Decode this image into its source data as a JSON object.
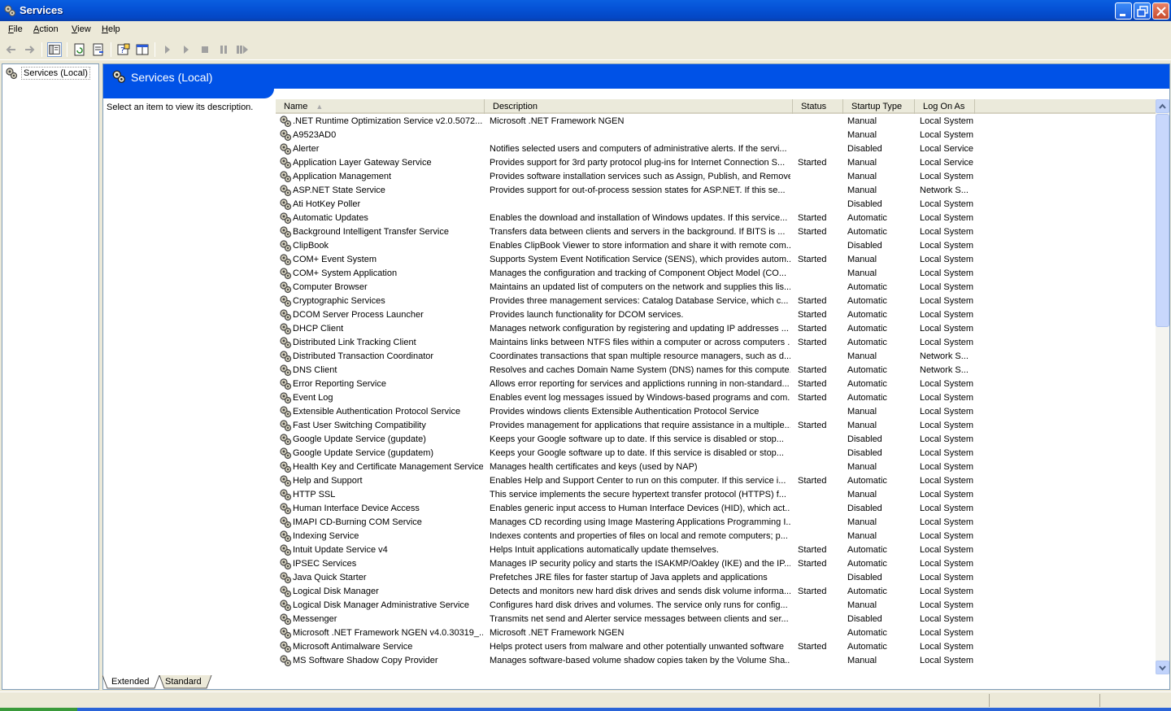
{
  "window": {
    "title": "Services"
  },
  "menu": [
    {
      "label": "File",
      "mnemonic": "F",
      "rest": "ile"
    },
    {
      "label": "Action",
      "mnemonic": "A",
      "rest": "ction"
    },
    {
      "label": "View",
      "mnemonic": "V",
      "rest": "iew"
    },
    {
      "label": "Help",
      "mnemonic": "H",
      "rest": "elp"
    }
  ],
  "tree": {
    "root_label": "Services (Local)"
  },
  "banner": {
    "title": "Services (Local)"
  },
  "description_pane": {
    "text": "Select an item to view its description."
  },
  "columns": [
    "Name",
    "Description",
    "Status",
    "Startup Type",
    "Log On As"
  ],
  "rows": [
    [
      ".NET Runtime Optimization Service v2.0.5072...",
      "Microsoft .NET Framework NGEN",
      "",
      "Manual",
      "Local System"
    ],
    [
      "A9523AD0",
      "",
      "",
      "Manual",
      "Local System"
    ],
    [
      "Alerter",
      "Notifies selected users and computers of administrative alerts. If the servi...",
      "",
      "Disabled",
      "Local Service"
    ],
    [
      "Application Layer Gateway Service",
      "Provides support for 3rd party protocol plug-ins for Internet Connection S...",
      "Started",
      "Manual",
      "Local Service"
    ],
    [
      "Application Management",
      "Provides software installation services such as Assign, Publish, and Remove.",
      "",
      "Manual",
      "Local System"
    ],
    [
      "ASP.NET State Service",
      "Provides support for out-of-process session states for ASP.NET. If this se...",
      "",
      "Manual",
      "Network S..."
    ],
    [
      "Ati HotKey Poller",
      "",
      "",
      "Disabled",
      "Local System"
    ],
    [
      "Automatic Updates",
      "Enables the download and installation of Windows updates. If this service...",
      "Started",
      "Automatic",
      "Local System"
    ],
    [
      "Background Intelligent Transfer Service",
      "Transfers data between clients and servers in the background. If BITS is ...",
      "Started",
      "Automatic",
      "Local System"
    ],
    [
      "ClipBook",
      "Enables ClipBook Viewer to store information and share it with remote com...",
      "",
      "Disabled",
      "Local System"
    ],
    [
      "COM+ Event System",
      "Supports System Event Notification Service (SENS), which provides autom...",
      "Started",
      "Manual",
      "Local System"
    ],
    [
      "COM+ System Application",
      "Manages the configuration and tracking of Component Object Model (CO...",
      "",
      "Manual",
      "Local System"
    ],
    [
      "Computer Browser",
      "Maintains an updated list of computers on the network and supplies this lis...",
      "",
      "Automatic",
      "Local System"
    ],
    [
      "Cryptographic Services",
      "Provides three management services: Catalog Database Service, which c...",
      "Started",
      "Automatic",
      "Local System"
    ],
    [
      "DCOM Server Process Launcher",
      "Provides launch functionality for DCOM services.",
      "Started",
      "Automatic",
      "Local System"
    ],
    [
      "DHCP Client",
      "Manages network configuration by registering and updating IP addresses ...",
      "Started",
      "Automatic",
      "Local System"
    ],
    [
      "Distributed Link Tracking Client",
      "Maintains links between NTFS files within a computer or across computers ...",
      "Started",
      "Automatic",
      "Local System"
    ],
    [
      "Distributed Transaction Coordinator",
      "Coordinates transactions that span multiple resource managers, such as d...",
      "",
      "Manual",
      "Network S..."
    ],
    [
      "DNS Client",
      "Resolves and caches Domain Name System (DNS) names for this compute...",
      "Started",
      "Automatic",
      "Network S..."
    ],
    [
      "Error Reporting Service",
      "Allows error reporting for services and applictions running in non-standard...",
      "Started",
      "Automatic",
      "Local System"
    ],
    [
      "Event Log",
      "Enables event log messages issued by Windows-based programs and com...",
      "Started",
      "Automatic",
      "Local System"
    ],
    [
      "Extensible Authentication Protocol Service",
      "Provides windows clients Extensible Authentication Protocol Service",
      "",
      "Manual",
      "Local System"
    ],
    [
      "Fast User Switching Compatibility",
      "Provides management for applications that require assistance in a multiple...",
      "Started",
      "Manual",
      "Local System"
    ],
    [
      "Google Update Service (gupdate)",
      "Keeps your Google software up to date. If this service is disabled or stop...",
      "",
      "Disabled",
      "Local System"
    ],
    [
      "Google Update Service (gupdatem)",
      "Keeps your Google software up to date. If this service is disabled or stop...",
      "",
      "Disabled",
      "Local System"
    ],
    [
      "Health Key and Certificate Management Service",
      "Manages health certificates and keys (used by NAP)",
      "",
      "Manual",
      "Local System"
    ],
    [
      "Help and Support",
      "Enables Help and Support Center to run on this computer. If this service i...",
      "Started",
      "Automatic",
      "Local System"
    ],
    [
      "HTTP SSL",
      "This service implements the secure hypertext transfer protocol (HTTPS) f...",
      "",
      "Manual",
      "Local System"
    ],
    [
      "Human Interface Device Access",
      "Enables generic input access to Human Interface Devices (HID), which act...",
      "",
      "Disabled",
      "Local System"
    ],
    [
      "IMAPI CD-Burning COM Service",
      "Manages CD recording using Image Mastering Applications Programming I...",
      "",
      "Manual",
      "Local System"
    ],
    [
      "Indexing Service",
      "Indexes contents and properties of files on local and remote computers; p...",
      "",
      "Manual",
      "Local System"
    ],
    [
      "Intuit Update Service v4",
      "Helps Intuit applications automatically update themselves.",
      "Started",
      "Automatic",
      "Local System"
    ],
    [
      "IPSEC Services",
      "Manages IP security policy and starts the ISAKMP/Oakley (IKE) and the IP...",
      "Started",
      "Automatic",
      "Local System"
    ],
    [
      "Java Quick Starter",
      "Prefetches JRE files for faster startup of Java applets and applications",
      "",
      "Disabled",
      "Local System"
    ],
    [
      "Logical Disk Manager",
      "Detects and monitors new hard disk drives and sends disk volume informa...",
      "Started",
      "Automatic",
      "Local System"
    ],
    [
      "Logical Disk Manager Administrative Service",
      "Configures hard disk drives and volumes. The service only runs for config...",
      "",
      "Manual",
      "Local System"
    ],
    [
      "Messenger",
      "Transmits net send and Alerter service messages between clients and ser...",
      "",
      "Disabled",
      "Local System"
    ],
    [
      "Microsoft .NET Framework NGEN v4.0.30319_...",
      "Microsoft .NET Framework NGEN",
      "",
      "Automatic",
      "Local System"
    ],
    [
      "Microsoft Antimalware Service",
      "Helps protect users from malware and other potentially unwanted software",
      "Started",
      "Automatic",
      "Local System"
    ],
    [
      "MS Software Shadow Copy Provider",
      "Manages software-based volume shadow copies taken by the Volume Sha...",
      "",
      "Manual",
      "Local System"
    ]
  ],
  "tabs": {
    "extended": "Extended",
    "standard": "Standard"
  }
}
